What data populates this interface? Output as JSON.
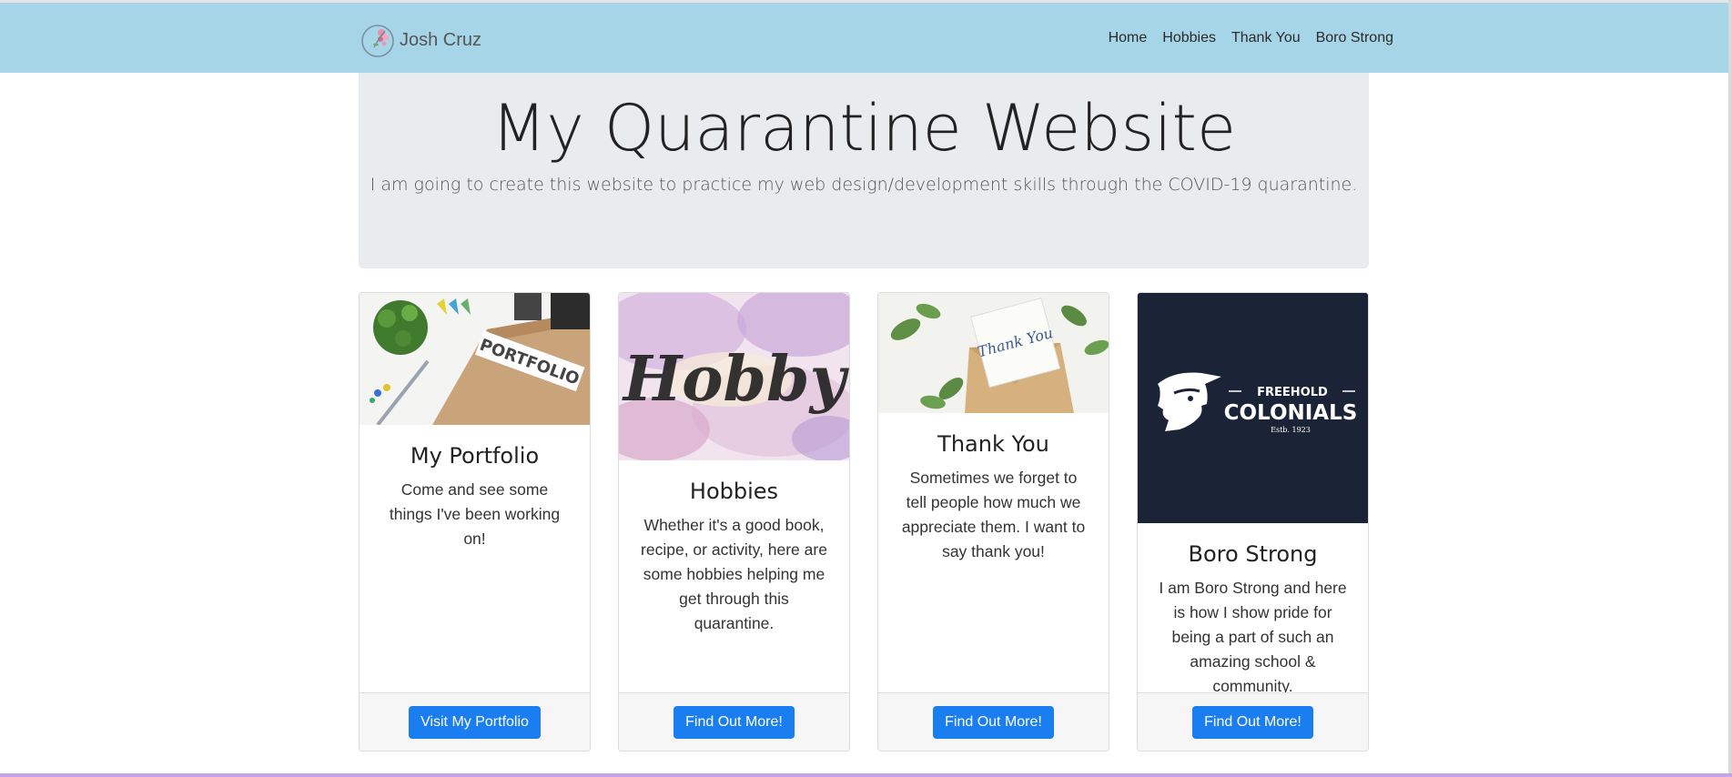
{
  "navbar": {
    "brand_name": "Josh Cruz",
    "links": [
      "Home",
      "Hobbies",
      "Thank You",
      "Boro Strong"
    ]
  },
  "hero": {
    "title": "My Quarantine Website",
    "lead": "I am going to create this website to practice my web design/development skills through the COVID-19 quarantine."
  },
  "cards": [
    {
      "title": "My Portfolio",
      "text": "Come and see some things I've been working on!",
      "button": "Visit My Portfolio",
      "image_label": "PORTFOLIO"
    },
    {
      "title": "Hobbies",
      "text": "Whether it's a good book, recipe, or activity, here are some hobbies helping me get through this quarantine.",
      "button": "Find Out More!",
      "image_label": "Hobby"
    },
    {
      "title": "Thank You",
      "text": "Sometimes we forget to tell people how much we appreciate them. I want to say thank you!",
      "button": "Find Out More!",
      "image_label": "Thank You"
    },
    {
      "title": "Boro Strong",
      "text": "I am Boro Strong and here is how I show pride for being a part of such an amazing school & community.",
      "button": "Find Out More!",
      "image_label_line1": "FREEHOLD",
      "image_label_line2": "COLONIALS",
      "image_label_line3": "Estb. 1923"
    }
  ],
  "colors": {
    "navbar": "#a6d5e7",
    "jumbotron": "#e9ecef",
    "button": "#1a7ef0",
    "colonials_bg": "#1b2336"
  }
}
